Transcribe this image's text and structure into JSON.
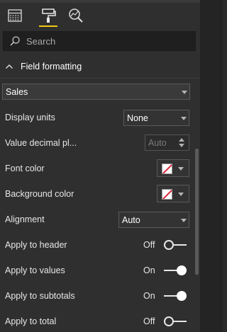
{
  "tabs": [
    {
      "name": "fields",
      "icon": "fields-icon",
      "active": false
    },
    {
      "name": "format",
      "icon": "paint-roller-icon",
      "active": true
    },
    {
      "name": "analytics",
      "icon": "analytics-icon",
      "active": false
    }
  ],
  "search": {
    "placeholder": "Search"
  },
  "section": {
    "title": "Field formatting"
  },
  "field_select": {
    "value": "Sales"
  },
  "display_units": {
    "label": "Display units",
    "value": "None"
  },
  "value_decimal": {
    "label": "Value decimal pl...",
    "value": "Auto"
  },
  "font_color": {
    "label": "Font color"
  },
  "background_color": {
    "label": "Background color"
  },
  "alignment": {
    "label": "Alignment",
    "value": "Auto"
  },
  "apply_header": {
    "label": "Apply to header",
    "state": "Off"
  },
  "apply_values": {
    "label": "Apply to values",
    "state": "On"
  },
  "apply_subtotals": {
    "label": "Apply to subtotals",
    "state": "On"
  },
  "apply_total": {
    "label": "Apply to total",
    "state": "Off"
  },
  "colors": {
    "accent": "#f2c811",
    "panel": "#2f2f2f",
    "swatch_line": "#d9273a"
  }
}
